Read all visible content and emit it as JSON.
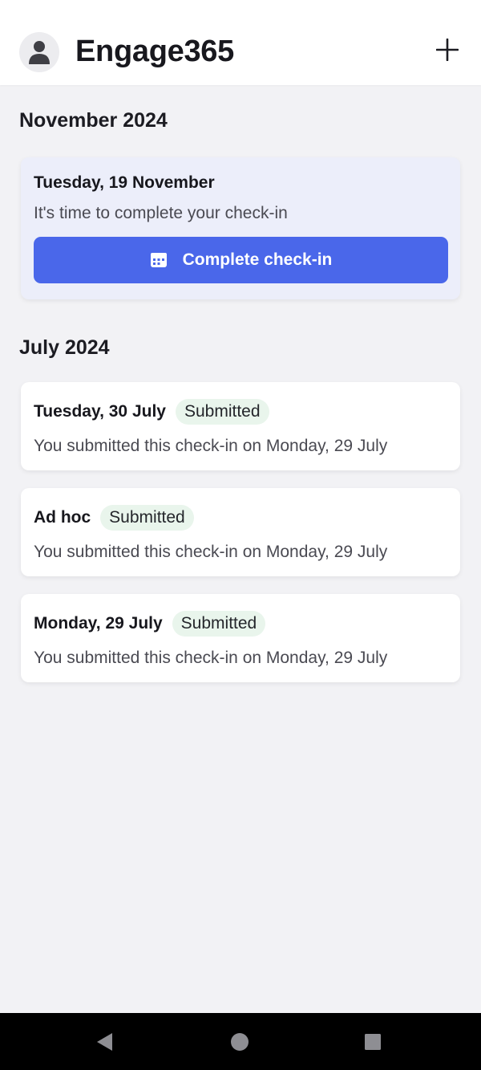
{
  "app": {
    "title": "Engage365"
  },
  "icons": {
    "profile": "person-icon",
    "add": "plus-icon",
    "checkin": "calendar-icon",
    "back": "triangle-back-icon",
    "home": "circle-home-icon",
    "recents": "square-recents-icon"
  },
  "colors": {
    "accent": "#4a67ea",
    "submitted_badge_bg": "#e9f5ec",
    "due_card_bg": "#eceefa"
  },
  "sections": [
    {
      "heading": "November 2024",
      "cards": [
        {
          "title": "Tuesday, 19 November",
          "subtitle": "It's time to complete your check-in",
          "button_label": "Complete check-in"
        }
      ]
    },
    {
      "heading": "July 2024",
      "cards": [
        {
          "title": "Tuesday, 30 July",
          "badge": "Submitted",
          "subtitle": "You submitted this check-in on Monday, 29 July"
        },
        {
          "title": "Ad hoc",
          "badge": "Submitted",
          "subtitle": "You submitted this check-in on Monday, 29 July"
        },
        {
          "title": "Monday, 29 July",
          "badge": "Submitted",
          "subtitle": "You submitted this check-in on Monday, 29 July"
        }
      ]
    }
  ]
}
